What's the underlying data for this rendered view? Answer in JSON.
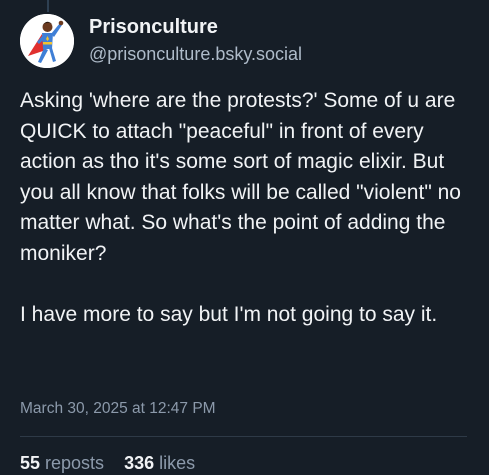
{
  "post": {
    "author": {
      "display_name": "Prisonculture",
      "handle": "@prisonculture.bsky.social",
      "avatar_icon": "superhero-avatar-icon"
    },
    "text": "Asking 'where are the protests?' Some of u are QUICK to attach \"peaceful\" in front of every action as tho it's some sort of magic elixir. But you all know that folks will be called \"violent\" no matter what. So what's the point of adding the moniker?\n\nI have more to say but I'm not going to say it.",
    "timestamp": "March 30, 2025 at 12:47 PM",
    "stats": {
      "reposts_count": "55",
      "reposts_label": "reposts",
      "likes_count": "336",
      "likes_label": "likes"
    }
  },
  "colors": {
    "background": "#161e27",
    "text_primary": "#f1f3f5",
    "text_secondary": "#8c9aab",
    "avatar_cape": "#e0302f",
    "avatar_suit": "#3f7fd6"
  }
}
